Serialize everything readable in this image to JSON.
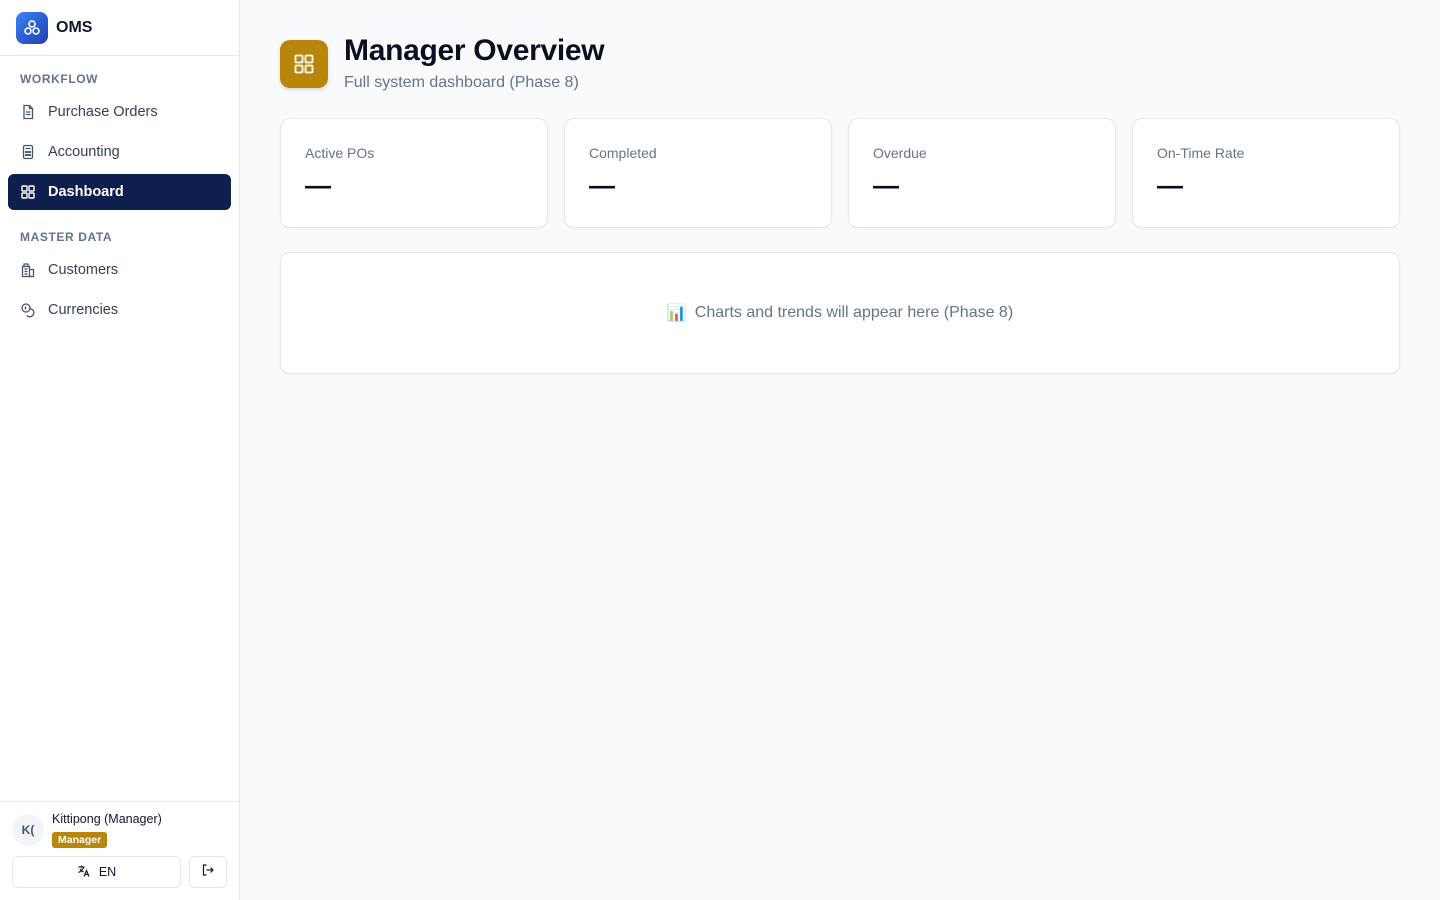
{
  "brand": {
    "name": "OMS"
  },
  "sidebar": {
    "sections": [
      {
        "title": "WORKFLOW",
        "items": [
          {
            "label": "Purchase Orders",
            "icon": "document-icon",
            "active": false
          },
          {
            "label": "Accounting",
            "icon": "calculator-icon",
            "active": false
          },
          {
            "label": "Dashboard",
            "icon": "grid-icon",
            "active": true
          }
        ]
      },
      {
        "title": "MASTER DATA",
        "items": [
          {
            "label": "Customers",
            "icon": "building-icon",
            "active": false
          },
          {
            "label": "Currencies",
            "icon": "coins-icon",
            "active": false
          }
        ]
      }
    ],
    "user": {
      "initials": "K(",
      "name": "Kittipong (Manager)",
      "role": "Manager"
    },
    "language_label": "EN"
  },
  "page": {
    "title": "Manager Overview",
    "subtitle": "Full system dashboard (Phase 8)"
  },
  "stats": [
    {
      "label": "Active POs",
      "value": "—"
    },
    {
      "label": "Completed",
      "value": "—"
    },
    {
      "label": "Overdue",
      "value": "—"
    },
    {
      "label": "On-Time Rate",
      "value": "—"
    }
  ],
  "chart_placeholder": {
    "emoji": "📊",
    "text": "Charts and trends will appear here (Phase 8)"
  },
  "colors": {
    "accent": "#b8860b",
    "active_nav": "#0f1f4d",
    "brand_logo": "#2563eb"
  }
}
